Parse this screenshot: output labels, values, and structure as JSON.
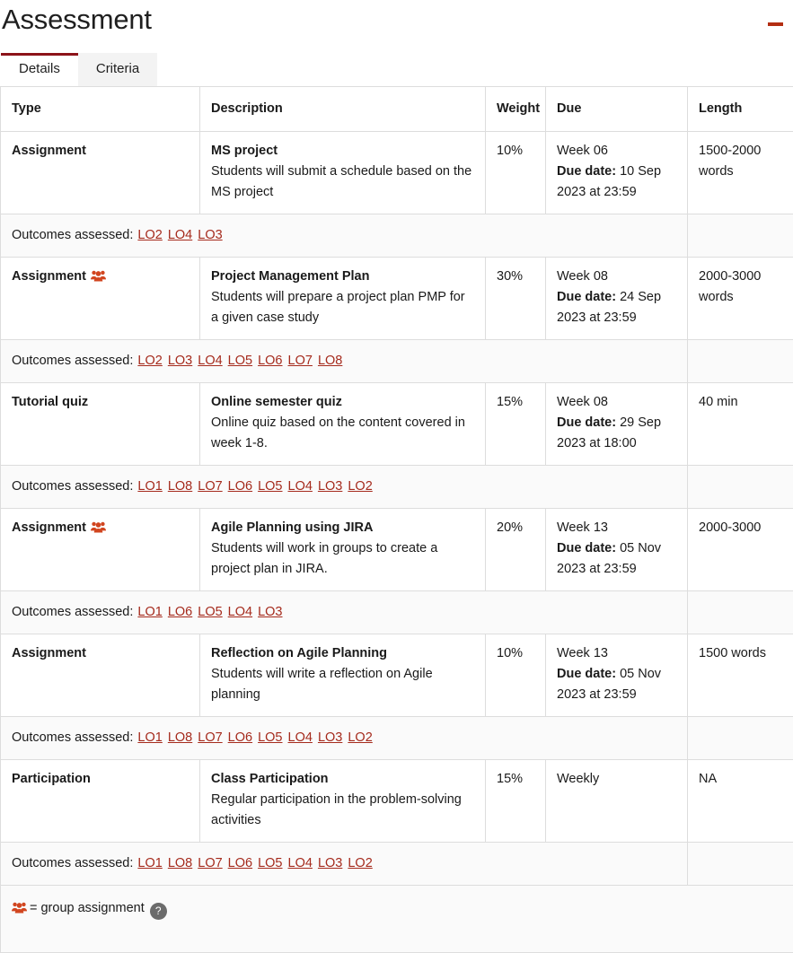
{
  "header": {
    "title": "Assessment",
    "collapse_icon": "minus-icon",
    "accent_color": "#b32d12"
  },
  "tabs": [
    {
      "label": "Details",
      "active": true
    },
    {
      "label": "Criteria",
      "active": false
    }
  ],
  "table": {
    "columns": [
      "Type",
      "Description",
      "Weight",
      "Due",
      "Length"
    ],
    "outcomes_label": "Outcomes assessed:",
    "due_date_label": "Due date:",
    "group_icon": "group-users-icon",
    "rows": [
      {
        "type": "Assignment",
        "group": false,
        "desc_title": "MS project",
        "desc_body": "Students will submit a schedule based on the MS project",
        "weight": "10%",
        "due_week": "Week 06",
        "due_date": "10 Sep 2023 at 23:59",
        "length": "1500-2000 words",
        "outcomes": [
          "LO2",
          "LO4",
          "LO3"
        ]
      },
      {
        "type": "Assignment",
        "group": true,
        "desc_title": "Project Management Plan",
        "desc_body": "Students will prepare a project plan PMP for a given case study",
        "weight": "30%",
        "due_week": "Week 08",
        "due_date": "24 Sep 2023 at 23:59",
        "length": "2000-3000 words",
        "outcomes": [
          "LO2",
          "LO3",
          "LO4",
          "LO5",
          "LO6",
          "LO7",
          "LO8"
        ]
      },
      {
        "type": "Tutorial quiz",
        "group": false,
        "desc_title": "Online semester quiz",
        "desc_body": "Online quiz based on the content covered in week 1-8.",
        "weight": "15%",
        "due_week": "Week 08",
        "due_date": "29 Sep 2023 at 18:00",
        "length": "40 min",
        "outcomes": [
          "LO1",
          "LO8",
          "LO7",
          "LO6",
          "LO5",
          "LO4",
          "LO3",
          "LO2"
        ]
      },
      {
        "type": "Assignment",
        "group": true,
        "desc_title": "Agile Planning using JIRA",
        "desc_body": "Students will work in groups to create a project plan in JIRA.",
        "weight": "20%",
        "due_week": "Week 13",
        "due_date": "05 Nov 2023 at 23:59",
        "length": "2000-3000",
        "outcomes": [
          "LO1",
          "LO6",
          "LO5",
          "LO4",
          "LO3"
        ]
      },
      {
        "type": "Assignment",
        "group": false,
        "desc_title": "Reflection on Agile Planning",
        "desc_body": "Students will write a reflection on Agile planning",
        "weight": "10%",
        "due_week": "Week 13",
        "due_date": "05 Nov 2023 at 23:59",
        "length": "1500 words",
        "outcomes": [
          "LO1",
          "LO8",
          "LO7",
          "LO6",
          "LO5",
          "LO4",
          "LO3",
          "LO2"
        ]
      },
      {
        "type": "Participation",
        "group": false,
        "desc_title": "Class Participation",
        "desc_body": "Regular participation in the problem-solving activities",
        "weight": "15%",
        "due_week": "Weekly",
        "due_date": "",
        "length": "NA",
        "outcomes": [
          "LO1",
          "LO8",
          "LO7",
          "LO6",
          "LO5",
          "LO4",
          "LO3",
          "LO2"
        ]
      }
    ]
  },
  "legend": {
    "icon": "group-users-icon",
    "text": "= group assignment",
    "help_label": "?",
    "icon_color": "#d1451f",
    "link_color": "#a52a1c"
  }
}
